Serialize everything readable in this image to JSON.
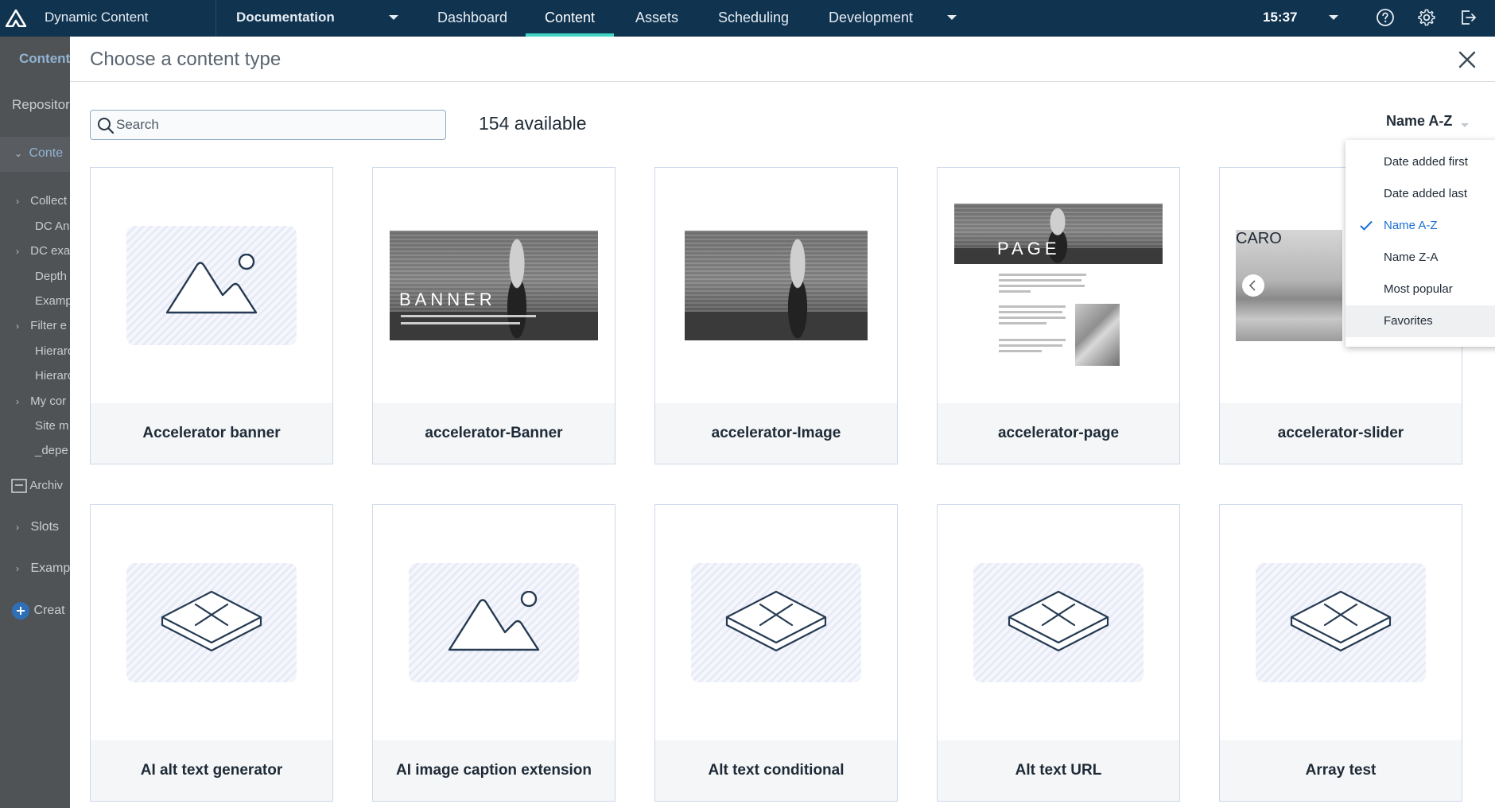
{
  "topbar": {
    "app_title": "Dynamic Content",
    "hub": "Documentation",
    "nav": [
      {
        "label": "Dashboard"
      },
      {
        "label": "Content"
      },
      {
        "label": "Assets"
      },
      {
        "label": "Scheduling"
      },
      {
        "label": "Development"
      }
    ],
    "active_nav": "Content",
    "time": "15:37"
  },
  "bg_panel": {
    "tab": "Content",
    "repository": "Repositor",
    "section": "Conte",
    "items": [
      "Collect",
      "DC Ann",
      "DC exa",
      "Depth",
      "Examp",
      "Filter e",
      "Hierarc",
      "Hierarc",
      "My cor",
      "Site m",
      "_depe"
    ],
    "archive": "Archiv",
    "slots": "Slots",
    "examples": "Examp",
    "create": "Creat"
  },
  "modal": {
    "title": "Choose a content type",
    "search_placeholder": "Search",
    "count": "154 available",
    "sort_label": "Name A-Z",
    "sort_options": [
      {
        "label": "Date added first"
      },
      {
        "label": "Date added last"
      },
      {
        "label": "Name A-Z"
      },
      {
        "label": "Name Z-A"
      },
      {
        "label": "Most popular"
      },
      {
        "label": "Favorites"
      }
    ],
    "selected_sort": "Name A-Z",
    "hovered_sort": "Favorites",
    "cards": [
      {
        "label": "Accelerator banner",
        "thumb": "image-placeholder"
      },
      {
        "label": "accelerator-Banner",
        "thumb": "banner-photo",
        "overlay": "BANNER"
      },
      {
        "label": "accelerator-Image",
        "thumb": "image-photo"
      },
      {
        "label": "accelerator-page",
        "thumb": "page-mock",
        "overlay": "PAGE"
      },
      {
        "label": "accelerator-slider",
        "thumb": "slider-photo",
        "overlay": "CARO"
      },
      {
        "label": "AI alt text generator",
        "thumb": "extension-placeholder"
      },
      {
        "label": "AI image caption extension",
        "thumb": "image-placeholder"
      },
      {
        "label": "Alt text conditional",
        "thumb": "extension-placeholder"
      },
      {
        "label": "Alt text URL",
        "thumb": "extension-placeholder"
      },
      {
        "label": "Array test",
        "thumb": "extension-placeholder"
      }
    ]
  },
  "colors": {
    "topbar_bg": "#103350",
    "active_tab_underline": "#41d6c3",
    "selected_option": "#1a6fd4",
    "overlay_bg": "#4f5356"
  }
}
